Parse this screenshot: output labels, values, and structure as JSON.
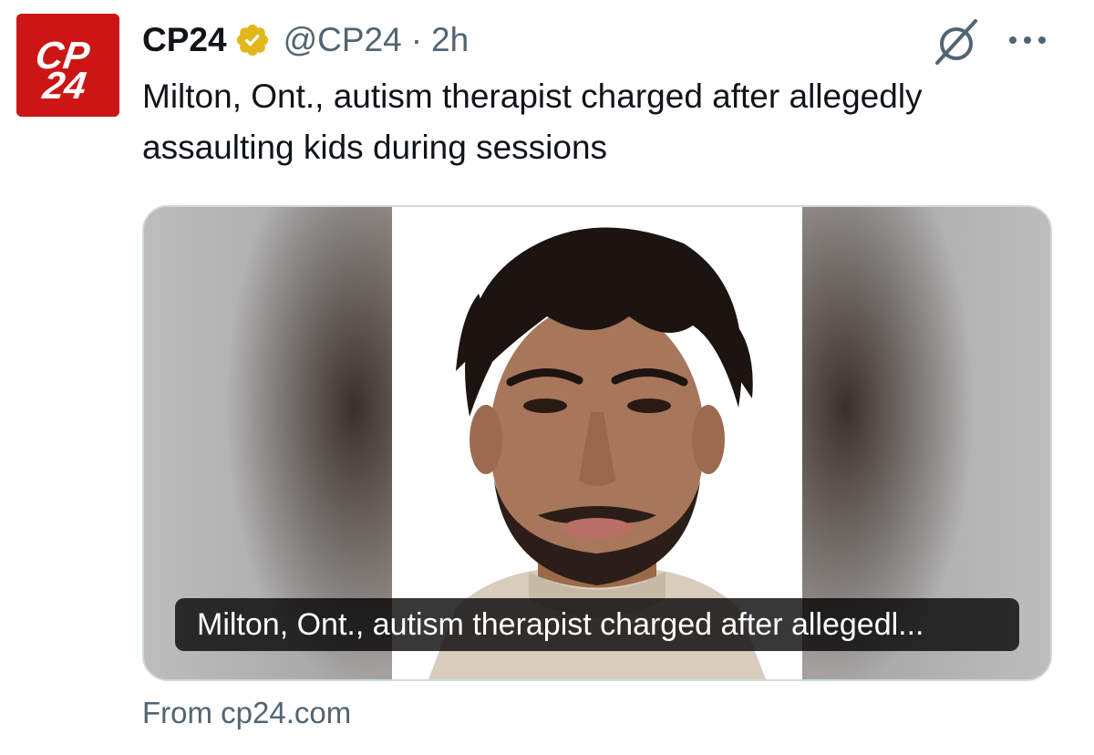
{
  "author": {
    "display_name": "CP24",
    "handle": "@CP24",
    "separator": "·",
    "time": "2h",
    "avatar_text_top": "CP",
    "avatar_text_bottom": "24",
    "avatar_color": "#cc1616",
    "verified_color": "#e2b719"
  },
  "tweet": {
    "text": "Milton, Ont., autism therapist charged after allegedly assaulting kids during sessions"
  },
  "card": {
    "caption": "Milton, Ont., autism therapist charged after allegedl...",
    "source": "From cp24.com"
  },
  "icons": {
    "grok": "grok-icon",
    "more": "more-icon",
    "verified": "verified-badge-icon"
  }
}
